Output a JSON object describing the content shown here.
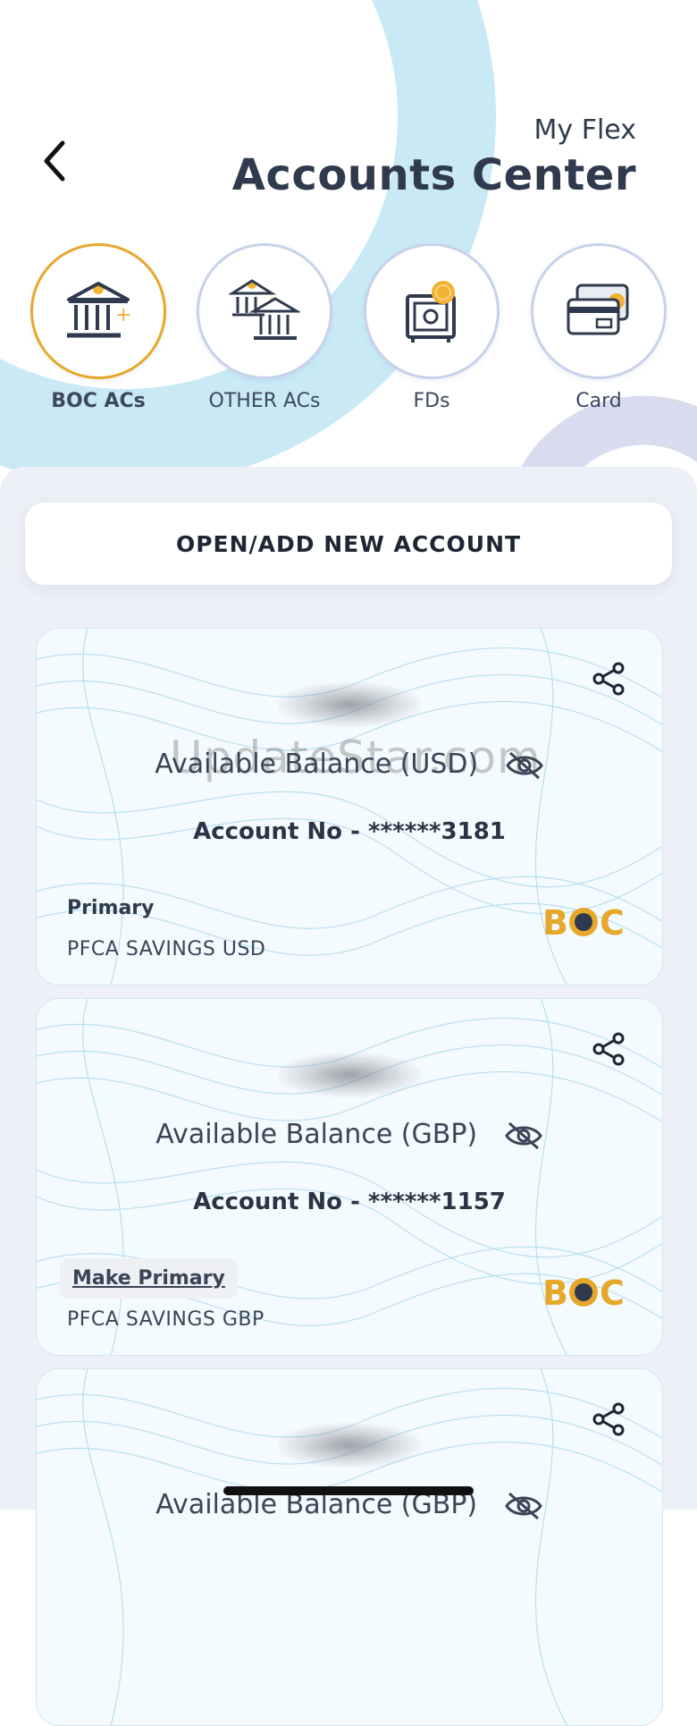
{
  "header": {
    "subtitle": "My Flex",
    "title": "Accounts Center"
  },
  "categories": [
    {
      "label": "BOC ACs",
      "icon": "bank-icon",
      "active": true
    },
    {
      "label": "OTHER ACs",
      "icon": "banks-icon",
      "active": false
    },
    {
      "label": "FDs",
      "icon": "safe-icon",
      "active": false
    },
    {
      "label": "Card",
      "icon": "card-icon",
      "active": false
    }
  ],
  "open_button": {
    "label": "OPEN/ADD NEW ACCOUNT"
  },
  "accounts": [
    {
      "balance_label": "Available Balance (USD)",
      "account_no": "Account No - ******3181",
      "status": "Primary",
      "type": "PFCA SAVINGS USD",
      "logo": "BOC"
    },
    {
      "balance_label": "Available Balance (GBP)",
      "account_no": "Account No - ******1157",
      "status": "Make Primary",
      "type": "PFCA SAVINGS GBP",
      "logo": "BOC"
    },
    {
      "balance_label": "Available Balance (GBP)"
    }
  ],
  "watermark": "UpdateStar.com",
  "colors": {
    "accent": "#e7a72b",
    "text_dark": "#2f3a4e",
    "panel_bg": "#eef0f7",
    "deco_blue": "#c9eaf5"
  }
}
